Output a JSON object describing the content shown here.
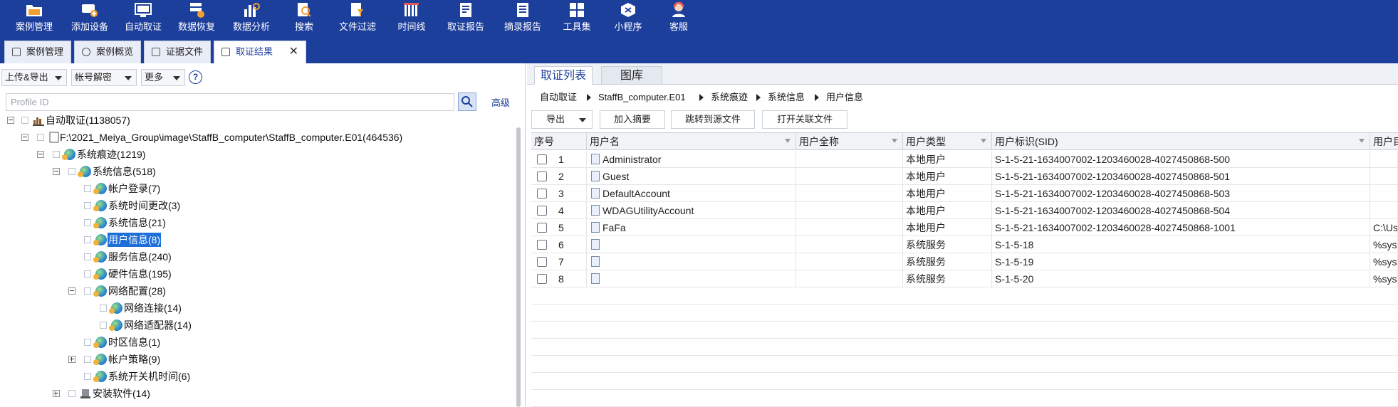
{
  "toolbar": {
    "items": [
      {
        "label": "案例管理",
        "icon": "folder-icon"
      },
      {
        "label": "添加设备",
        "icon": "add-device-icon"
      },
      {
        "label": "自动取证",
        "icon": "auto-icon"
      },
      {
        "label": "数据恢复",
        "icon": "recover-icon"
      },
      {
        "label": "数据分析",
        "icon": "analysis-icon"
      },
      {
        "label": "搜索",
        "icon": "search-doc-icon"
      },
      {
        "label": "文件过滤",
        "icon": "filter-doc-icon"
      },
      {
        "label": "时间线",
        "icon": "timeline-icon"
      },
      {
        "label": "取证报告",
        "icon": "report-icon"
      },
      {
        "label": "摘录报告",
        "icon": "excerpt-icon"
      },
      {
        "label": "工具集",
        "icon": "tools-icon"
      },
      {
        "label": "小程序",
        "icon": "miniapp-icon"
      },
      {
        "label": "客服",
        "icon": "support-icon"
      }
    ]
  },
  "tabs": [
    {
      "label": "案例管理"
    },
    {
      "label": "案例概览"
    },
    {
      "label": "证据文件"
    },
    {
      "label": "取证结果",
      "active": true
    }
  ],
  "tab_close": "✕",
  "left": {
    "dropdowns": [
      "上传&导出",
      "帐号解密",
      "更多"
    ],
    "help": "?",
    "search_placeholder": "Profile ID",
    "advanced": "高级",
    "tree": [
      {
        "label": "自动取证(1138057)"
      },
      {
        "label": "F:\\2021_Meiya_Group\\image\\StaffB_computer\\StaffB_computer.E01(464536)"
      },
      {
        "label": "系统痕迹(1219)"
      },
      {
        "label": "系统信息(518)"
      },
      {
        "label": "帐户登录(7)"
      },
      {
        "label": "系统时间更改(3)"
      },
      {
        "label": "系统信息(21)"
      },
      {
        "label": "用户信息(8)"
      },
      {
        "label": "服务信息(240)"
      },
      {
        "label": "硬件信息(195)"
      },
      {
        "label": "网络配置(28)"
      },
      {
        "label": "网络连接(14)"
      },
      {
        "label": "网络适配器(14)"
      },
      {
        "label": "时区信息(1)"
      },
      {
        "label": "帐户策略(9)"
      },
      {
        "label": "系统开关机时间(6)"
      },
      {
        "label": "安装软件(14)"
      }
    ]
  },
  "right": {
    "tabs": [
      "取证列表",
      "图库"
    ],
    "breadcrumb": [
      "自动取证",
      "StaffB_computer.E01",
      "系统痕迹",
      "系统信息",
      "用户信息"
    ],
    "actions": [
      "导出",
      "加入摘要",
      "跳转到源文件",
      "打开关联文件"
    ],
    "columns": [
      "序号",
      "用户名",
      "用户全称",
      "用户类型",
      "用户标识(SID)",
      "用户目"
    ],
    "rows": [
      {
        "no": "1",
        "name": "Administrator",
        "full": "",
        "type": "本地用户",
        "sid": "S-1-5-21-1634007002-1203460028-4027450868-500",
        "dir": ""
      },
      {
        "no": "2",
        "name": "Guest",
        "full": "",
        "type": "本地用户",
        "sid": "S-1-5-21-1634007002-1203460028-4027450868-501",
        "dir": ""
      },
      {
        "no": "3",
        "name": "DefaultAccount",
        "full": "",
        "type": "本地用户",
        "sid": "S-1-5-21-1634007002-1203460028-4027450868-503",
        "dir": ""
      },
      {
        "no": "4",
        "name": "WDAGUtilityAccount",
        "full": "",
        "type": "本地用户",
        "sid": "S-1-5-21-1634007002-1203460028-4027450868-504",
        "dir": ""
      },
      {
        "no": "5",
        "name": "FaFa",
        "full": "",
        "type": "本地用户",
        "sid": "S-1-5-21-1634007002-1203460028-4027450868-1001",
        "dir": "C:\\Us"
      },
      {
        "no": "6",
        "name": "",
        "full": "",
        "type": "系统服务",
        "sid": "S-1-5-18",
        "dir": "%syst"
      },
      {
        "no": "7",
        "name": "",
        "full": "",
        "type": "系统服务",
        "sid": "S-1-5-19",
        "dir": "%syst"
      },
      {
        "no": "8",
        "name": "",
        "full": "",
        "type": "系统服务",
        "sid": "S-1-5-20",
        "dir": "%syst"
      }
    ]
  },
  "colors": {
    "brand": "#1d3f9c",
    "selection": "#1e6fd9"
  }
}
